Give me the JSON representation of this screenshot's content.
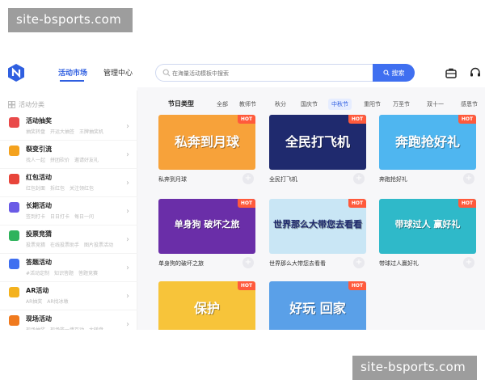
{
  "watermarks": {
    "top": "site-bsports.com",
    "bottom": "site-bsports.com"
  },
  "header": {
    "tabs": [
      {
        "label": "活动市场"
      },
      {
        "label": "管理中心"
      }
    ],
    "search_placeholder": "在海量活动模板中搜索",
    "search_button": "搜索"
  },
  "sidebar": {
    "heading": "活动分类",
    "items": [
      {
        "title": "活动抽奖",
        "subs": [
          "抽奖转盘",
          "开运大抽签",
          "王牌抽奖机"
        ],
        "color": "#e94a4a"
      },
      {
        "title": "裂变引流",
        "subs": [
          "找人一起",
          "拼团砍价",
          "邀请好友礼"
        ],
        "color": "#f4a21e"
      },
      {
        "title": "红包活动",
        "subs": [
          "红包封面",
          "拆红包",
          "关注领红包"
        ],
        "color": "#e8453a"
      },
      {
        "title": "长期活动",
        "subs": [
          "签到打卡",
          "日日打卡",
          "每日一问"
        ],
        "color": "#6a5be6"
      },
      {
        "title": "投票竞猜",
        "subs": [
          "投票竞猜",
          "在线投票助手",
          "图片投票活动"
        ],
        "color": "#2fb35c"
      },
      {
        "title": "答题活动",
        "subs": [
          "#活动定制",
          "知识答题",
          "答题竞赛"
        ],
        "color": "#3f6ff0"
      },
      {
        "title": "AR活动",
        "subs": [
          "AR抽奖",
          "AR找冰墩"
        ],
        "color": "#f4b21e"
      },
      {
        "title": "现场活动",
        "subs": [
          "现场抽奖",
          "现场签一墙互动",
          "大转盘"
        ],
        "color": "#f07a1e"
      }
    ]
  },
  "filter": {
    "label": "节日类型",
    "chips": [
      "全部",
      "教师节",
      "秋分",
      "国庆节",
      "中秋节",
      "重阳节",
      "万圣节",
      "双十一",
      "感恩节"
    ],
    "active_index": 4
  },
  "cards": [
    {
      "title": "私奔到月球",
      "art": "私奔到月球",
      "hot": "HOT",
      "bg": "#f7a23a"
    },
    {
      "title": "全民打飞机",
      "art": "全民打飞机",
      "hot": "HOT",
      "bg": "#1f2a6e"
    },
    {
      "title": "奔跑抢好礼",
      "art": "奔跑抢好礼",
      "hot": "HOT",
      "bg": "#4fb6f0"
    },
    {
      "title": "单身狗的破坏之旅",
      "art": "单身狗 破坏之旅",
      "hot": "HOT",
      "bg": "#6a2ea8"
    },
    {
      "title": "世界那么大带您去看看",
      "art": "世界那么大带您去看看",
      "hot": "HOT",
      "bg": "#c9e6f5"
    },
    {
      "title": "带球过人赢好礼",
      "art": "带球过人 赢好礼",
      "hot": "HOT",
      "bg": "#2fb9c9"
    },
    {
      "title": "",
      "art": "保护",
      "hot": "HOT",
      "bg": "#f7c43a"
    },
    {
      "title": "",
      "art": "好玩 回家",
      "hot": "HOT",
      "bg": "#5aa0e8"
    }
  ]
}
